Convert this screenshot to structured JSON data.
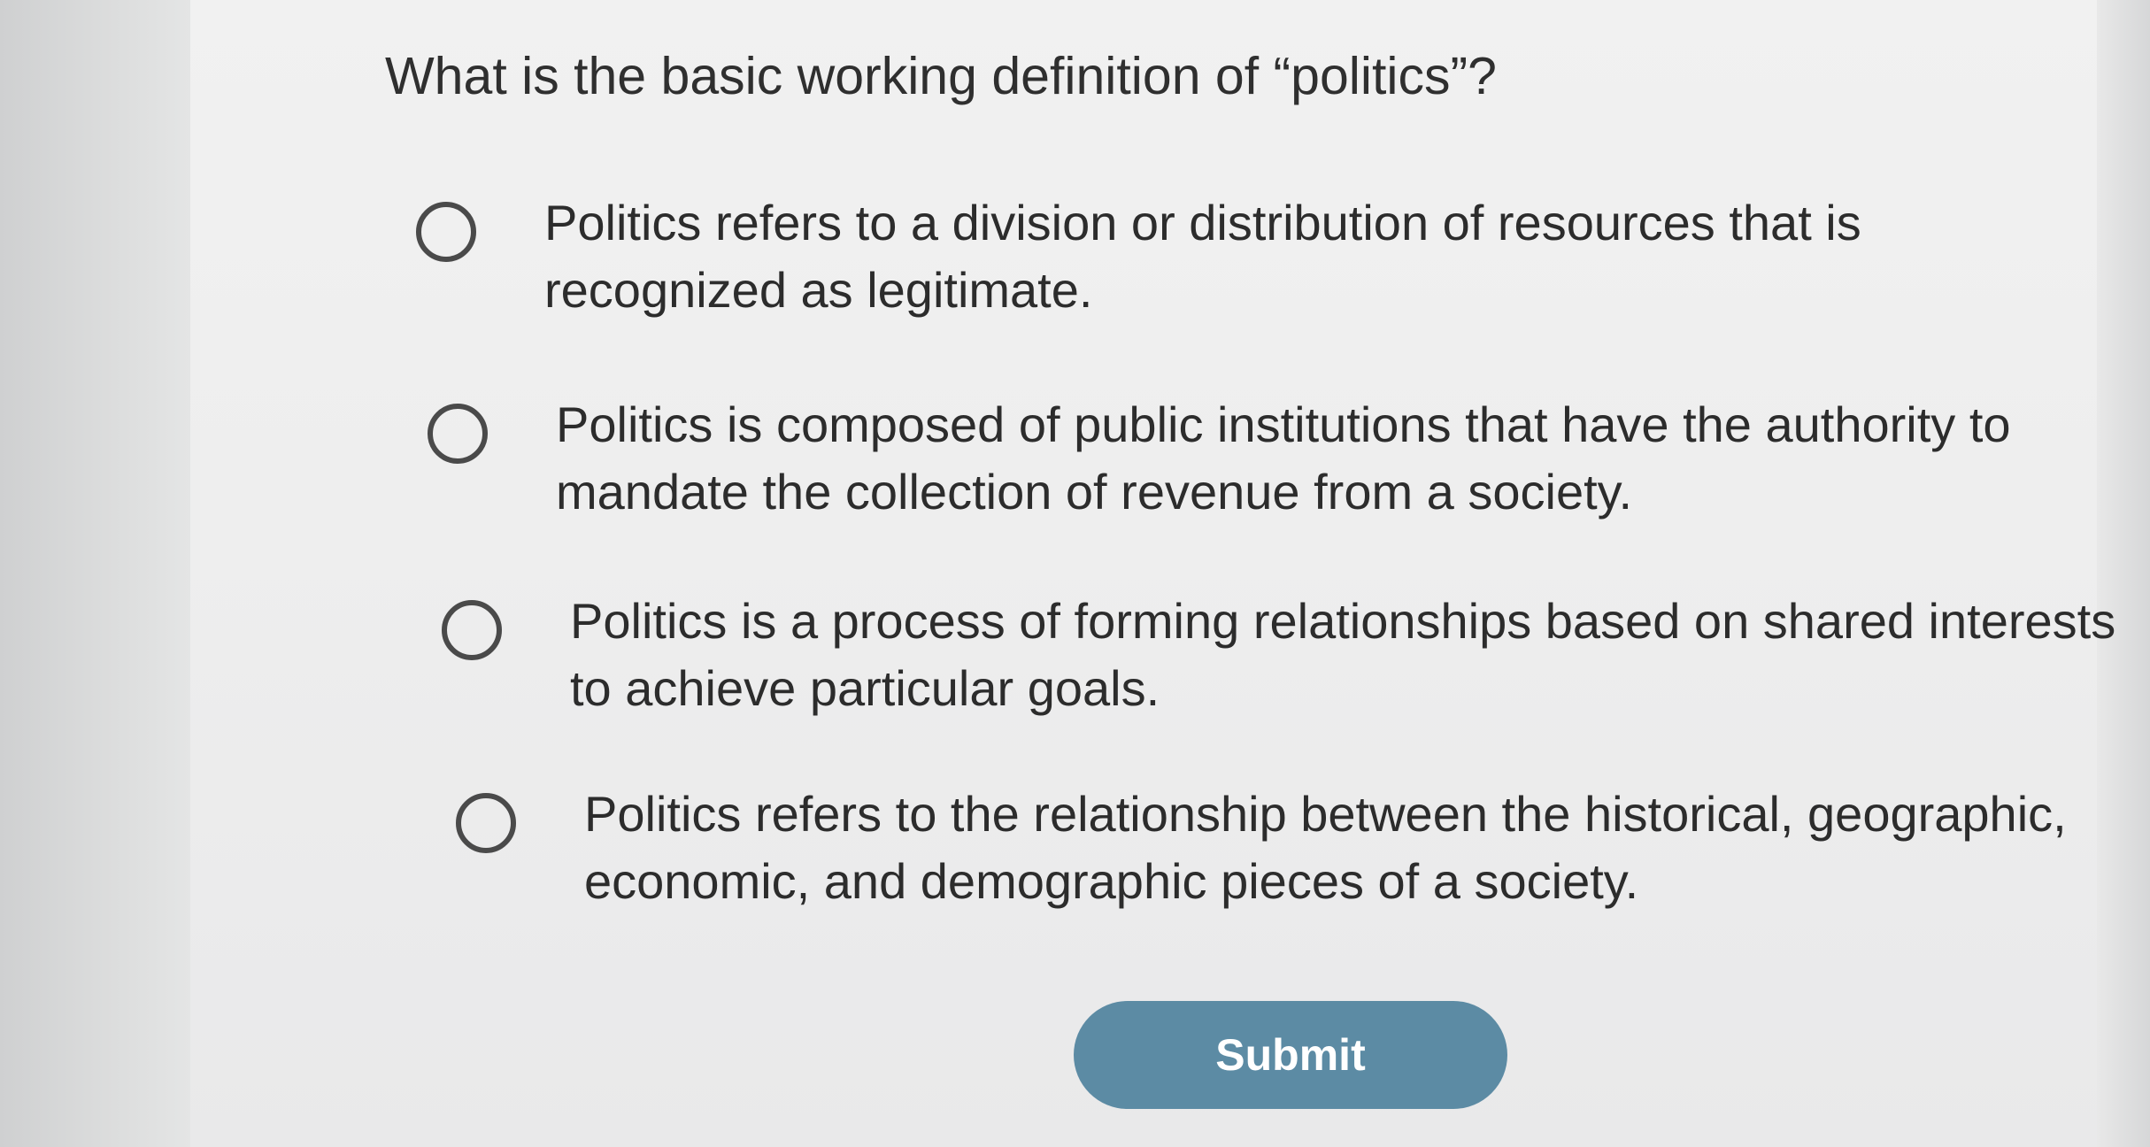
{
  "question": {
    "text": "What is the basic working definition of “politics”?"
  },
  "options": [
    {
      "text": "Politics refers to a division or distribution of resources that is recognized as legitimate.",
      "selected": false
    },
    {
      "text": "Politics is composed of public institutions that have the authority to mandate the collection of revenue from a society.",
      "selected": false
    },
    {
      "text": "Politics is a process of forming relationships based on shared interests to achieve particular goals.",
      "selected": false
    },
    {
      "text": "Politics refers to the relationship between the historical, geographic, economic, and demographic pieces of a society.",
      "selected": false
    }
  ],
  "submit": {
    "label": "Submit"
  },
  "colors": {
    "submit_button": "#5c8ba4",
    "text": "#2c2c2c",
    "radio_border": "#4a4a4a",
    "card_background": "#efefef"
  }
}
